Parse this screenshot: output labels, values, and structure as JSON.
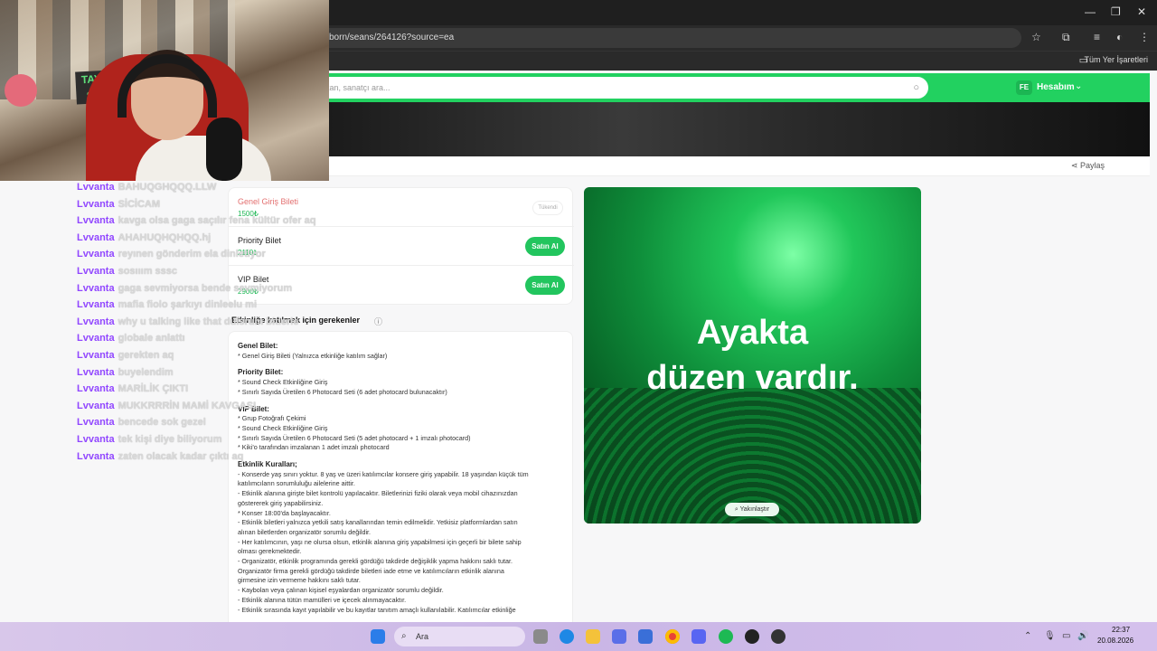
{
  "browser": {
    "url": "born/seans/264126?source=ea",
    "bookmarks_label": "Tüm Yer İşaretleri"
  },
  "site": {
    "search_placeholder": "kan, sanatçı ara...",
    "avatar_initials": "FE",
    "account_label": "Hesabım",
    "share_label": "Paylaş"
  },
  "tickets": [
    {
      "name": "Genel Giriş Bileti",
      "price": "1500₺",
      "status": "Tükendi"
    },
    {
      "name": "Priority Bilet",
      "price": "2110₺",
      "button": "Satın Al"
    },
    {
      "name": "VIP Bilet",
      "price": "2900₺",
      "button": "Satın Al"
    }
  ],
  "need_section_title": "Etkinliğe katılmak için gerekenler",
  "description": [
    {
      "type": "head",
      "text": "Genel Bilet:"
    },
    {
      "type": "line",
      "text": "* Genel Giriş Bileti (Yalnızca etkinliğe katılım sağlar)"
    },
    {
      "type": "head",
      "text": "Priority Bilet:"
    },
    {
      "type": "line",
      "text": "* Sound Check Etkinliğine Giriş"
    },
    {
      "type": "line",
      "text": "* Sınırlı Sayıda Üretilen 6 Photocard Seti (6 adet photocard bulunacaktır)"
    },
    {
      "type": "head",
      "text": "VIP Bilet:"
    },
    {
      "type": "line",
      "text": "* Grup Fotoğrafı Çekimi"
    },
    {
      "type": "line",
      "text": "* Sound Check Etkinliğine Giriş"
    },
    {
      "type": "line",
      "text": "* Sınırlı Sayıda Üretilen 6 Photocard Seti (5 adet photocard + 1 imzalı photocard)"
    },
    {
      "type": "line",
      "text": "* Kiki'o tarafından imzalanan 1 adet imzalı photocard"
    },
    {
      "type": "head",
      "text": "Etkinlik Kuralları;"
    },
    {
      "type": "line",
      "text": "- Konserde yaş sınırı yoktur. 8 yaş ve üzeri katılımcılar konsere giriş yapabilir. 18 yaşından küçük tüm"
    },
    {
      "type": "line",
      "text": "katılımcıların sorumluluğu ailelerine aittir."
    },
    {
      "type": "line",
      "text": "- Etkinlik alanına girişte bilet kontrolü yapılacaktır. Biletlerinizi fiziki olarak veya mobil cihazınızdan"
    },
    {
      "type": "line",
      "text": "göstererek giriş yapabilirsiniz."
    },
    {
      "type": "line",
      "text": "* Konser 18:00'da başlayacaktır."
    },
    {
      "type": "line",
      "text": "- Etkinlik biletleri yalnızca yetkili satış kanallarından temin edilmelidir. Yetkisiz platformlardan satın"
    },
    {
      "type": "line",
      "text": "alınan biletlerden organizatör sorumlu değildir."
    },
    {
      "type": "line",
      "text": "- Her katılımcının, yaşı ne olursa olsun, etkinlik alanına giriş yapabilmesi için geçerli bir bilete sahip"
    },
    {
      "type": "line",
      "text": "olması gerekmektedir."
    },
    {
      "type": "line",
      "text": "- Organizatör, etkinlik programında gerekli gördüğü takdirde değişiklik yapma hakkını saklı tutar."
    },
    {
      "type": "line",
      "text": "Organizatör firma gerekli gördüğü takdirde biletleri iade etme ve katılımcıların etkinlik alanına"
    },
    {
      "type": "line",
      "text": "girmesine izin vermeme hakkını saklı tutar."
    },
    {
      "type": "line",
      "text": "- Kaybolan veya çalınan kişisel eşyalardan organizatör sorumlu değildir."
    },
    {
      "type": "line",
      "text": "- Etkinlik alanına tütün mamülleri ve içecek alınmayacaktır."
    },
    {
      "type": "line",
      "text": "- Etkinlik sırasında kayıt yapılabilir ve bu kayıtlar tanıtım amaçlı kullanılabilir. Katılımcılar etkinliğe"
    }
  ],
  "poster": {
    "line1": "Ayakta",
    "line2": "düzen vardır.",
    "zoom_label": "Yakınlaştır"
  },
  "webcam": {
    "sign_text": "TAYLOR SWIFT"
  },
  "chat": [
    {
      "user": "Lvvanta",
      "msg": "BAHUQGHQQQ.LLW"
    },
    {
      "user": "Lvvanta",
      "msg": "SİCİCAM"
    },
    {
      "user": "Lvvanta",
      "msg": "kavga olsa gaga saçılır fena kültür ofer aq"
    },
    {
      "user": "Lvvanta",
      "msg": "AHAHUQHQHQQ.hj"
    },
    {
      "user": "Lvvanta",
      "msg": "reyınen gönderim ela dinletiyor"
    },
    {
      "user": "Lvvanta",
      "msg": "sosııım sssc"
    },
    {
      "user": "Lvvanta",
      "msg": "gaga sevmiyorsa bende sevmiyorum"
    },
    {
      "user": "Lvvanta",
      "msg": "mafia fiolo şarkıyı dinleelu mi"
    },
    {
      "user": "Lvvanta",
      "msg": "why u talking like that dulsrum bitlerle"
    },
    {
      "user": "Lvvanta",
      "msg": "globale anlattı"
    },
    {
      "user": "Lvvanta",
      "msg": "gerekten aq"
    },
    {
      "user": "Lvvanta",
      "msg": "buyelendim"
    },
    {
      "user": "Lvvanta",
      "msg": "MARİLİK ÇIKTI"
    },
    {
      "user": "Lvvanta",
      "msg": "MUKKRRRİN MAMİ KAVGASI"
    },
    {
      "user": "Lvvanta",
      "msg": "bencede sok gezel"
    },
    {
      "user": "Lvvanta",
      "msg": "tek kişi diye biliyorum"
    },
    {
      "user": "Lvvanta",
      "msg": "zaten olacak kadar çıktı aq"
    }
  ],
  "taskbar": {
    "search_label": "Ara",
    "time": "22:37",
    "date": "20.08.2026"
  }
}
